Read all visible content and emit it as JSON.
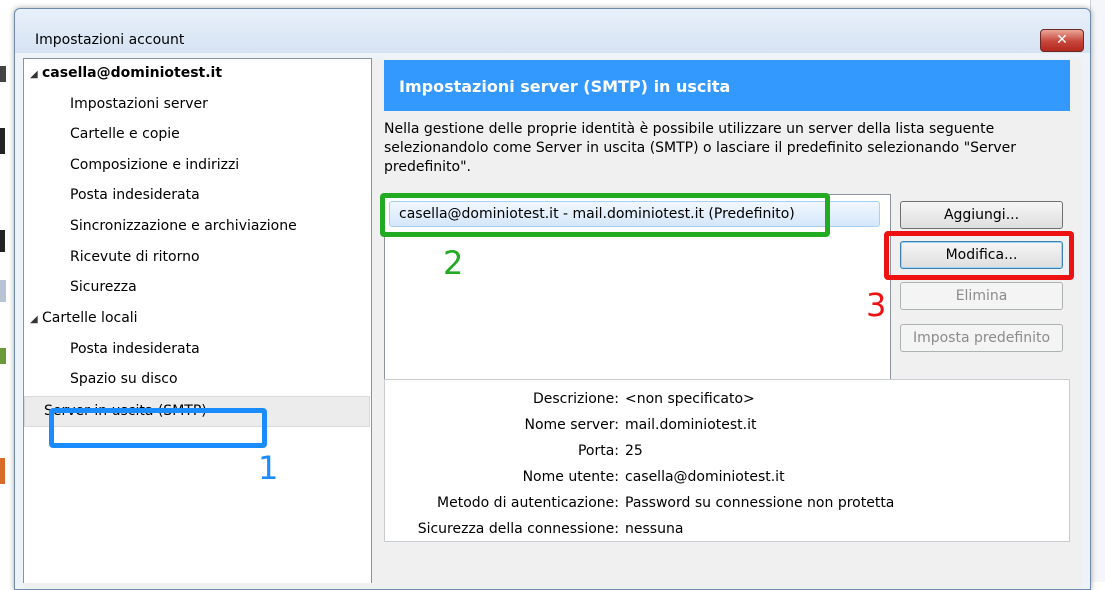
{
  "window": {
    "title": "Impostazioni account",
    "close_glyph": "✕"
  },
  "tree": {
    "account": "casella@dominiotest.it",
    "account_items": [
      "Impostazioni server",
      "Cartelle e copie",
      "Composizione e indirizzi",
      "Posta indesiderata",
      "Sincronizzazione e archiviazione",
      "Ricevute di ritorno",
      "Sicurezza"
    ],
    "local": "Cartelle locali",
    "local_items": [
      "Posta indesiderata",
      "Spazio su disco"
    ],
    "selected": "Server in uscita (SMTP)"
  },
  "panel": {
    "header": "Impostazioni server (SMTP) in uscita",
    "description": "Nella gestione delle proprie identità è possibile utilizzare un server della lista seguente selezionandolo come Server in uscita (SMTP) o lasciare il predefinito selezionando \"Server predefinito\".",
    "servers": [
      "casella@dominiotest.it - mail.dominiotest.it (Predefinito)"
    ],
    "buttons": {
      "add": "Aggiungi...",
      "edit": "Modifica...",
      "delete": "Elimina",
      "set_default": "Imposta predefinito"
    }
  },
  "details": [
    {
      "label": "Descrizione:",
      "value": "<non specificato>"
    },
    {
      "label": "Nome server:",
      "value": "mail.dominiotest.it"
    },
    {
      "label": "Porta:",
      "value": "25"
    },
    {
      "label": "Nome utente:",
      "value": "casella@dominiotest.it"
    },
    {
      "label": "Metodo di autenticazione:",
      "value": "Password su connessione non protetta"
    },
    {
      "label": "Sicurezza della connessione:",
      "value": "nessuna"
    }
  ],
  "annotations": [
    {
      "number": "1",
      "color": "#1a8cff"
    },
    {
      "number": "2",
      "color": "#22aa22"
    },
    {
      "number": "3",
      "color": "#ee1111"
    }
  ]
}
